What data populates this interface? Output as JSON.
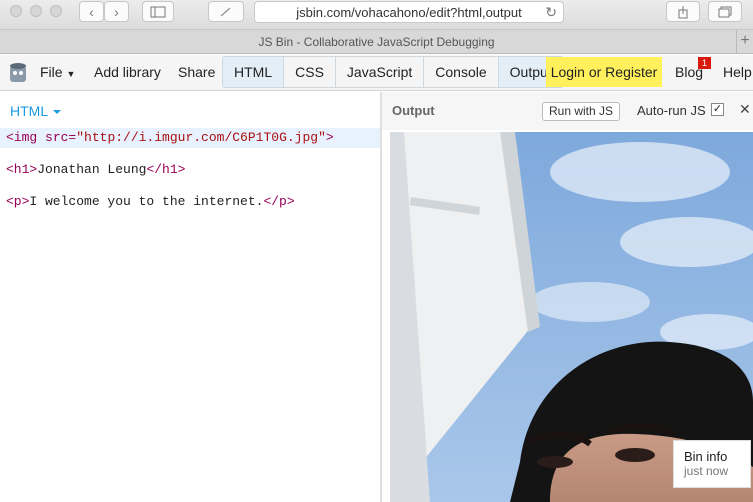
{
  "browser": {
    "url": "jsbin.com/vohacahono/edit?html,output",
    "tab_title": "JS Bin - Collaborative JavaScript Debugging"
  },
  "toolbar": {
    "file_label": "File",
    "add_library_label": "Add library",
    "share_label": "Share",
    "panels": [
      "HTML",
      "CSS",
      "JavaScript",
      "Console",
      "Output"
    ],
    "login_label": "Login or Register",
    "blog_label": "Blog",
    "blog_badge": "1",
    "help_label": "Help"
  },
  "editor": {
    "language_label": "HTML",
    "lines": [
      {
        "open": "<img ",
        "attr": "src=",
        "value": "\"http://i.imgur.com/C6P1T0G.jpg\"",
        "close": ">"
      },
      {
        "open": "<h1>",
        "text": "Jonathan Leung",
        "close": "</h1>"
      },
      {
        "open": "<p>",
        "text": "I welcome you to the internet.",
        "close": "</p>"
      }
    ]
  },
  "output": {
    "label": "Output",
    "run_button": "Run with JS",
    "autorun_label": "Auto-run JS",
    "autorun_checked": "✓",
    "close_glyph": "✕"
  },
  "bin_info": {
    "title": "Bin info",
    "subtitle": "just now"
  },
  "colors": {
    "accent": "#1d9be2",
    "login_bg": "#fff05c",
    "badge_bg": "#d9190c"
  }
}
